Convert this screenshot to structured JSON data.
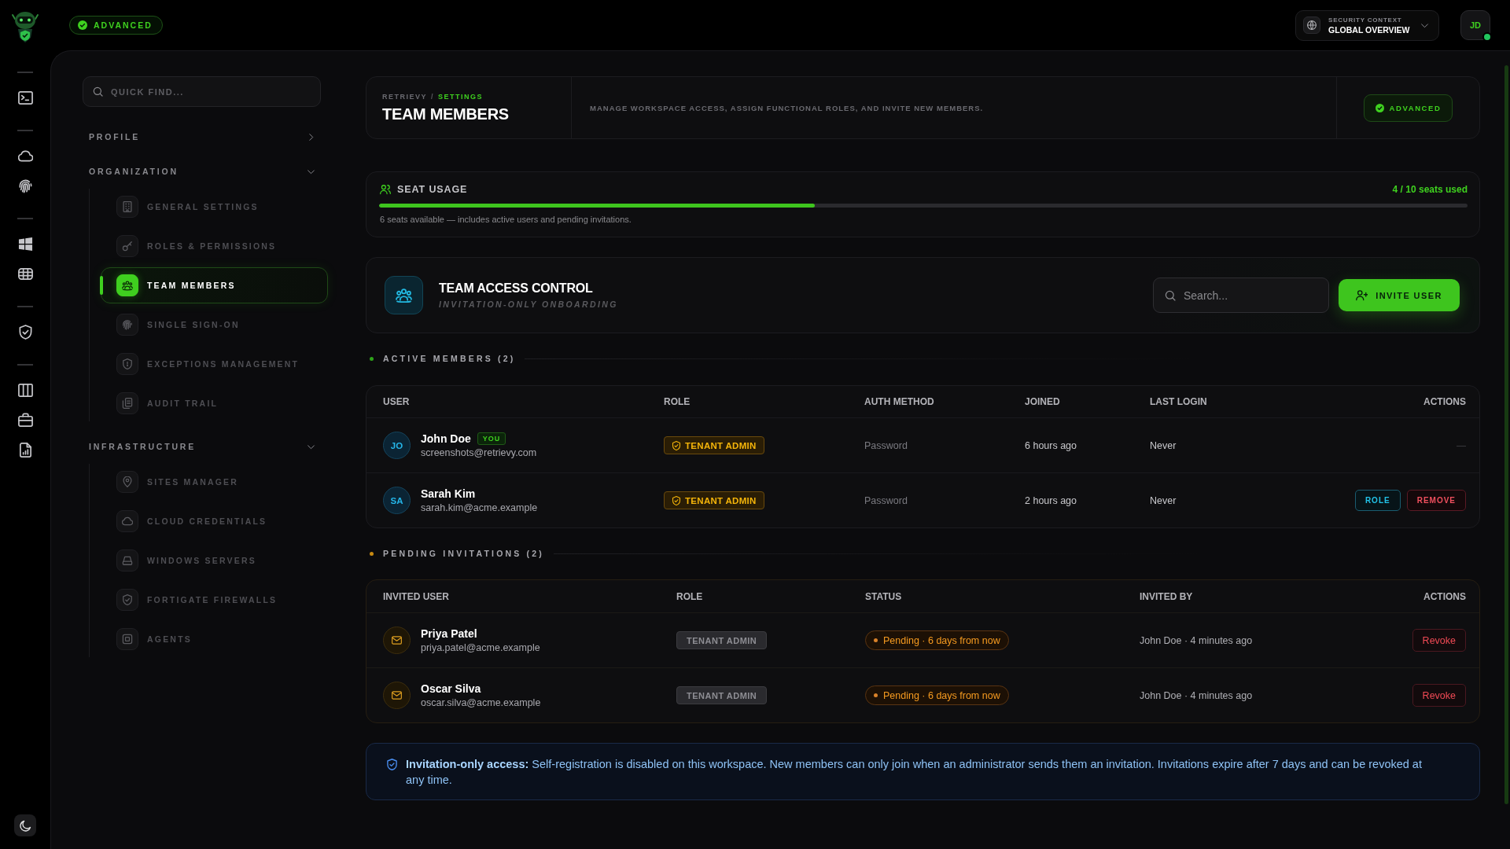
{
  "top_bar": {
    "badge": "ADVANCED",
    "security_context": {
      "label": "SECURITY CONTEXT",
      "value": "GLOBAL OVERVIEW"
    },
    "avatar": {
      "initials": "JD",
      "online": true
    }
  },
  "sidebar": {
    "search": {
      "placeholder": "QUICK FIND..."
    },
    "sections": [
      {
        "title": "PROFILE",
        "expanded": false
      },
      {
        "title": "ORGANIZATION",
        "expanded": true,
        "items": [
          {
            "label": "GENERAL SETTINGS",
            "selected": false
          },
          {
            "label": "ROLES & PERMISSIONS",
            "selected": false
          },
          {
            "label": "TEAM MEMBERS",
            "selected": true
          },
          {
            "label": "SINGLE SIGN-ON",
            "selected": false
          },
          {
            "label": "EXCEPTIONS MANAGEMENT",
            "selected": false
          },
          {
            "label": "AUDIT TRAIL",
            "selected": false
          }
        ]
      },
      {
        "title": "INFRASTRUCTURE",
        "expanded": true,
        "items": [
          {
            "label": "SITES MANAGER",
            "selected": false
          },
          {
            "label": "CLOUD CREDENTIALS",
            "selected": false
          },
          {
            "label": "WINDOWS SERVERS",
            "selected": false
          },
          {
            "label": "FORTIGATE FIREWALLS",
            "selected": false
          },
          {
            "label": "AGENTS",
            "selected": false
          }
        ]
      }
    ]
  },
  "page_header": {
    "breadcrumb": [
      "RETRIEVY",
      "SETTINGS"
    ],
    "breadcrumb_separator": "/",
    "title": "TEAM MEMBERS",
    "description": "MANAGE WORKSPACE ACCESS, ASSIGN FUNCTIONAL ROLES, AND INVITE NEW MEMBERS.",
    "badge": "ADVANCED"
  },
  "seat_usage": {
    "title": "SEAT USAGE",
    "summary": "4 / 10 seats used",
    "level": 0.4,
    "note": "6 seats available — includes active users and pending invitations."
  },
  "access_control": {
    "title": "TEAM ACCESS CONTROL",
    "subtitle": "INVITATION-ONLY ONBOARDING",
    "search": {
      "placeholder": "Search..."
    },
    "invite_button": "INVITE USER"
  },
  "active_members": {
    "heading": "ACTIVE MEMBERS (2)",
    "columns": [
      "USER",
      "ROLE",
      "AUTH METHOD",
      "JOINED",
      "LAST LOGIN",
      "ACTIONS"
    ],
    "rows": [
      {
        "initials": "JO",
        "name": "John Doe",
        "tag": "YOU",
        "email": "screenshots@retrievy.com",
        "role": "TENANT ADMIN",
        "auth_method": "Password",
        "joined": "6 hours ago",
        "last_login": "Never",
        "actions": [
          {
            "kind": "none",
            "label": "—"
          }
        ]
      },
      {
        "initials": "SA",
        "name": "Sarah Kim",
        "email": "sarah.kim@acme.example",
        "role": "TENANT ADMIN",
        "auth_method": "Password",
        "joined": "2 hours ago",
        "last_login": "Never",
        "actions": [
          {
            "kind": "role",
            "label": "ROLE"
          },
          {
            "kind": "remove",
            "label": "REMOVE"
          }
        ]
      }
    ]
  },
  "pending_invitations": {
    "heading": "PENDING INVITATIONS (2)",
    "columns": [
      "INVITED USER",
      "ROLE",
      "STATUS",
      "INVITED BY",
      "ACTIONS"
    ],
    "rows": [
      {
        "name": "Priya Patel",
        "email": "priya.patel@acme.example",
        "role": "TENANT ADMIN",
        "status": "Pending · 6 days from now",
        "invited_by": "John Doe · 4 minutes ago",
        "action": "Revoke"
      },
      {
        "name": "Oscar Silva",
        "email": "oscar.silva@acme.example",
        "role": "TENANT ADMIN",
        "status": "Pending · 6 days from now",
        "invited_by": "John Doe · 4 minutes ago",
        "action": "Revoke"
      }
    ]
  },
  "notice": {
    "text": "**Invitation-only access:** Self-registration is disabled on this workspace. New members can only join when an administrator sends them an invitation. Invitations expire after 7 days and can be revoked at any time."
  }
}
